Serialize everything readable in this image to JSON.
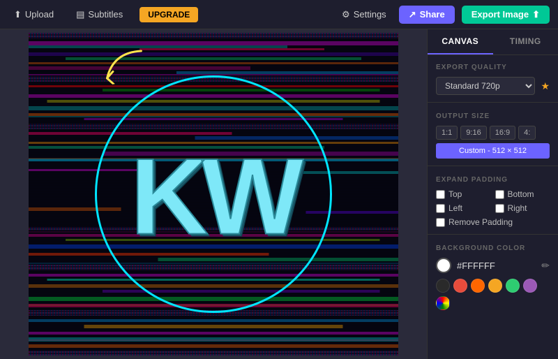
{
  "topbar": {
    "upload_label": "Upload",
    "subtitles_label": "Subtitles",
    "upgrade_label": "UPGRADE",
    "settings_label": "Settings",
    "share_label": "Share",
    "export_label": "Export Image"
  },
  "panel": {
    "tab_canvas": "CANVAS",
    "tab_timing": "TIMING",
    "export_quality_label": "EXPORT QUALITY",
    "quality_value": "Standard 720p",
    "output_size_label": "OUTPUT SIZE",
    "size_1_1": "1:1",
    "size_9_16": "9:16",
    "size_16_9": "16:9",
    "size_4": "4:",
    "size_custom": "Custom - 512 × 512",
    "expand_padding_label": "EXPAND PADDING",
    "top_label": "Top",
    "bottom_label": "Bottom",
    "left_label": "Left",
    "right_label": "Right",
    "remove_padding_label": "Remove Padding",
    "bg_color_label": "BACKGROUND COLOR",
    "hex_value": "#FFFFFF",
    "swatches": [
      {
        "color": "#2a2a2a",
        "name": "dark"
      },
      {
        "color": "#e74c3c",
        "name": "red"
      },
      {
        "color": "#ff6600",
        "name": "orange"
      },
      {
        "color": "#f5a623",
        "name": "yellow"
      },
      {
        "color": "#2ecc71",
        "name": "green"
      },
      {
        "color": "#9b59b6",
        "name": "purple"
      },
      {
        "color": "#ccc",
        "name": "gradient"
      }
    ]
  },
  "canvas": {
    "kw_text": "KW"
  }
}
